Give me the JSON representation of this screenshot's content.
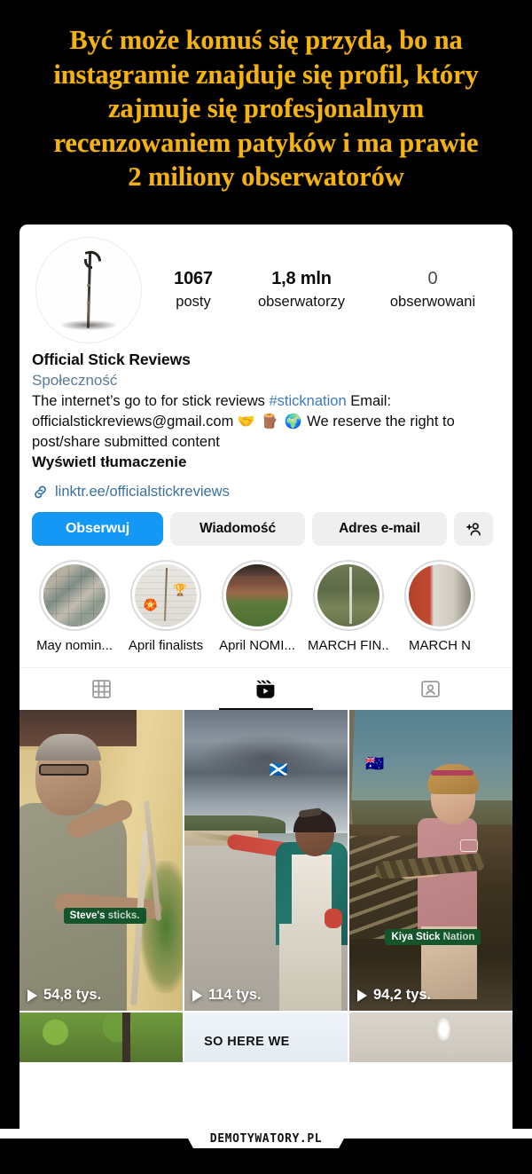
{
  "post": {
    "title_lines": [
      "Być może komuś się przyda, bo na",
      "instagramie znajduje się profil, który",
      "zajmuje się profesjonalnym",
      "recenzowaniem patyków i ma prawie",
      "2 miliony obserwatorów"
    ],
    "title_color": "#f5b312",
    "background_color": "#000000",
    "watermark": "DEMOTYWATORY.PL"
  },
  "profile": {
    "avatar_alt": "walking-stick",
    "stats": [
      {
        "value": "1067",
        "label": "posty"
      },
      {
        "value": "1,8 mln",
        "label": "obserwatorzy"
      },
      {
        "value": "0",
        "label": "obserwowani"
      }
    ],
    "display_name": "Official Stick Reviews",
    "category": "Społeczność",
    "bio_part1": "The internet’s go to for stick reviews ",
    "bio_hashtag": "#sticknation",
    "bio_part2": " Email: officialstickreviews@gmail.com ",
    "bio_emoji": "🤝 🪵 🌍",
    "bio_part3": "  We reserve the right to post/share submitted content",
    "translate_label": "Wyświetl tłumaczenie",
    "link": "linktr.ee/officialstickreviews",
    "link_color": "#3a72a4",
    "accent_color": "#1399f5"
  },
  "actions": [
    {
      "label": "Obserwuj",
      "style": "primary"
    },
    {
      "label": "Wiadomość",
      "style": "secondary"
    },
    {
      "label": "Adres e-mail",
      "style": "secondary"
    }
  ],
  "highlights": [
    {
      "label": "May nomin...",
      "thumb": "collage"
    },
    {
      "label": "April finalists",
      "thumb": "siding"
    },
    {
      "label": "April NOMI...",
      "thumb": "brick"
    },
    {
      "label": "MARCH FIN...",
      "thumb": "grass"
    },
    {
      "label": "MARCH N",
      "thumb": "door"
    }
  ],
  "tabs": [
    {
      "icon": "grid-icon",
      "active": false
    },
    {
      "icon": "reels-icon",
      "active": true
    },
    {
      "icon": "tagged-icon",
      "active": false
    }
  ],
  "reels": [
    {
      "views": "54,8 tys.",
      "caption_bold": "Steve's",
      "caption_dim": " sticks.",
      "flag": ""
    },
    {
      "views": "114 tys.",
      "caption_bold": "",
      "caption_dim": "",
      "flag": "🏴󠁧󠁢󠁳󠁣󠁴󠁿"
    },
    {
      "views": "94,2 tys.",
      "caption_bold": "Kiya Stick",
      "caption_dim": " Nation",
      "flag": "🇦🇺"
    }
  ],
  "bottom_row": {
    "middle_text": "SO HERE WE"
  }
}
